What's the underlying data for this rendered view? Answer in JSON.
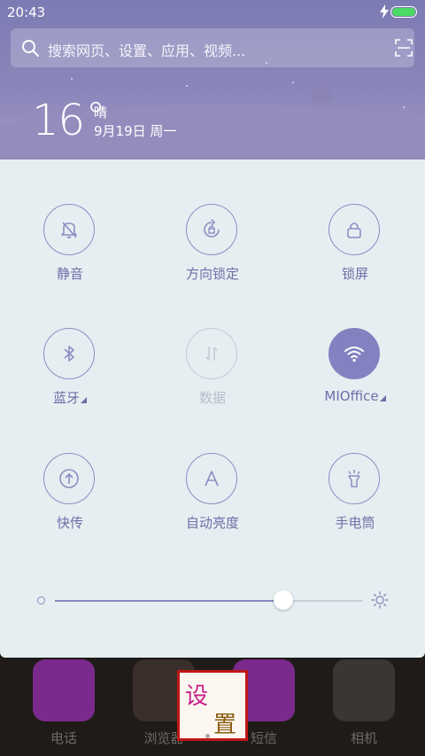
{
  "status_bar": {
    "time": "20:43"
  },
  "search": {
    "placeholder": "搜索网页、设置、应用、视频..."
  },
  "weather": {
    "temperature": "16",
    "degree_symbol": "°",
    "condition": "晴",
    "date": "9月19日 周一"
  },
  "toggles": [
    {
      "label": "静音",
      "icon": "bell-off-icon",
      "state": "off"
    },
    {
      "label": "方向锁定",
      "icon": "rotation-lock-icon",
      "state": "off"
    },
    {
      "label": "锁屏",
      "icon": "lock-icon",
      "state": "off"
    },
    {
      "label": "蓝牙",
      "icon": "bluetooth-icon",
      "state": "off"
    },
    {
      "label": "数据",
      "icon": "data-arrows-icon",
      "state": "disabled"
    },
    {
      "label": "MIOffice",
      "icon": "wifi-icon",
      "state": "on"
    },
    {
      "label": "快传",
      "icon": "share-upload-icon",
      "state": "off"
    },
    {
      "label": "自动亮度",
      "icon": "auto-brightness-icon",
      "state": "off"
    },
    {
      "label": "手电筒",
      "icon": "flashlight-icon",
      "state": "off"
    }
  ],
  "brightness": {
    "level": 0.74
  },
  "dock": {
    "apps": [
      {
        "label": "电话",
        "icon": "phone-icon",
        "color": "#7a2a8c"
      },
      {
        "label": "浏览器",
        "icon": "browser-icon",
        "color": "#3a2f2a"
      },
      {
        "label": "短信",
        "icon": "message-icon",
        "color": "#7a2a8c"
      },
      {
        "label": "相机",
        "icon": "camera-icon",
        "color": "#3a3633"
      }
    ],
    "overlay": {
      "char1": "设",
      "char2": "置"
    }
  },
  "colors": {
    "accent": "#8382c1",
    "panel": "#e7eef1",
    "label": "#6b6fa8"
  }
}
